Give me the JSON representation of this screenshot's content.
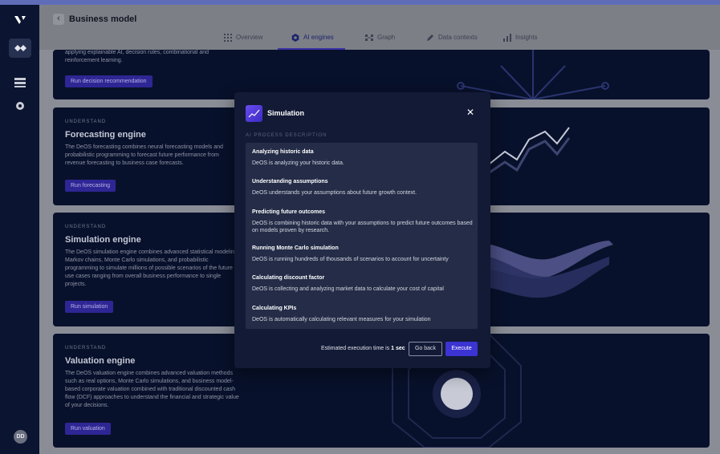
{
  "app": {
    "title": "Business model",
    "avatar_initials": "DD",
    "accent_color": "#3b33d2"
  },
  "tabs": [
    {
      "label": "Overview",
      "icon": "grid-icon"
    },
    {
      "label": "AI engines",
      "icon": "hexagon-icon",
      "active": true
    },
    {
      "label": "Graph",
      "icon": "graph-icon"
    },
    {
      "label": "Data contexts",
      "icon": "pencil-icon"
    },
    {
      "label": "Insights",
      "icon": "bar-chart-icon"
    }
  ],
  "cards": {
    "decision": {
      "desc_tail": "applying explainable AI, decision rules, combinational and reinforcement learning.",
      "button": "Run decision recommendation"
    },
    "forecasting": {
      "kicker": "UNDERSTAND",
      "title": "Forecasting engine",
      "desc": "The DeOS forecasting combines neural forecasting models and probabilistic programming to forecast future performance from revenue forecasting to business case forecasts.",
      "button": "Run forecasting"
    },
    "simulation": {
      "kicker": "UNDERSTAND",
      "title": "Simulation engine",
      "desc": "The DeOS simulation engine combines advanced statistical modeling, Markov chains, Monte Carlo simulations, and probabilistic programming to simulate millions of possible scenarios of the future in use cases ranging from overall business performance to single projects.",
      "button": "Run simulation"
    },
    "valuation": {
      "kicker": "UNDERSTAND",
      "title": "Valuation engine",
      "desc": "The DeOS valuation engine combines advanced valuation methods such as real options, Monte Carlo simulations, and business model-based corporate valuation combined with traditional discounted cash flow (DCF) approaches to understand the financial and strategic value of your decisions.",
      "button": "Run valuation"
    }
  },
  "modal": {
    "title": "Simulation",
    "section_label": "AI PROCESS DESCRIPTION",
    "steps": [
      {
        "title": "Analyzing historic data",
        "desc": "DeOS is analyzing your historic data."
      },
      {
        "title": "Understanding assumptions",
        "desc": "DeOS understands your assumptions about future growth context."
      },
      {
        "title": "Predicting future outcomes",
        "desc": "DeOS is combining historic data with your assumptions to predict future outcomes based on models proven by research."
      },
      {
        "title": "Running Monte Carlo simulation",
        "desc": "DeOS is running hundreds of thousands of scenarios to account for uncertainty"
      },
      {
        "title": "Calculating discount factor",
        "desc": "DeOS is collecting and analyzing market data to calculate your cost of capital"
      },
      {
        "title": "Calculating KPIs",
        "desc": "DeOS is automatically calculating relevant measures for your simulation"
      }
    ],
    "footer_prefix": "Estimated execution time is ",
    "footer_time": "1 sec",
    "go_back": "Go back",
    "execute": "Execute"
  }
}
